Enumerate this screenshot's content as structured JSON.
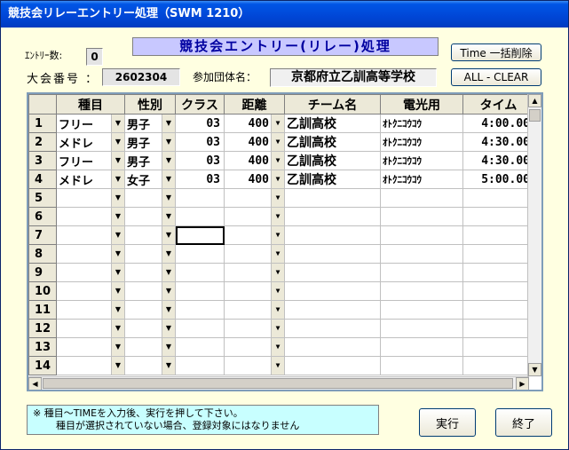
{
  "window": {
    "title": "競技会リレーエントリー処理（SWM 1210）"
  },
  "header": {
    "entry_count_label": "ｴﾝﾄﾘｰ数:",
    "entry_count_value": "0",
    "meet_number_label": "大会番号 ：",
    "meet_number_value": "2602304",
    "team_label": "参加団体名：",
    "team_value": "京都府立乙訓高等学校",
    "banner": "競技会エントリー(リレー)処理"
  },
  "toolbar": {
    "time_clear_label": "Time 一括削除",
    "all_clear_label": "ALL - CLEAR"
  },
  "grid": {
    "columns": [
      "種目",
      "性別",
      "クラス",
      "距離",
      "チーム名",
      "電光用",
      "タイム"
    ],
    "rows": [
      {
        "no": "1",
        "event": "フリー",
        "sex": "男子",
        "class": "03",
        "distance": "400",
        "team": "乙訓高校",
        "display": "ｵﾄｸﾆｺｳｺｳ",
        "time": "4:00.00"
      },
      {
        "no": "2",
        "event": "メドレ",
        "sex": "男子",
        "class": "03",
        "distance": "400",
        "team": "乙訓高校",
        "display": "ｵﾄｸﾆｺｳｺｳ",
        "time": "4:30.00"
      },
      {
        "no": "3",
        "event": "フリー",
        "sex": "男子",
        "class": "03",
        "distance": "400",
        "team": "乙訓高校",
        "display": "ｵﾄｸﾆｺｳｺｳ",
        "time": "4:30.00"
      },
      {
        "no": "4",
        "event": "メドレ",
        "sex": "女子",
        "class": "03",
        "distance": "400",
        "team": "乙訓高校",
        "display": "ｵﾄｸﾆｺｳｺｳ",
        "time": "5:00.00"
      },
      {
        "no": "5",
        "event": "",
        "sex": "",
        "class": "",
        "distance": "",
        "team": "",
        "display": "",
        "time": ""
      },
      {
        "no": "6",
        "event": "",
        "sex": "",
        "class": "",
        "distance": "",
        "team": "",
        "display": "",
        "time": ""
      },
      {
        "no": "7",
        "event": "",
        "sex": "",
        "class": "",
        "distance": "",
        "team": "",
        "display": "",
        "time": ""
      },
      {
        "no": "8",
        "event": "",
        "sex": "",
        "class": "",
        "distance": "",
        "team": "",
        "display": "",
        "time": ""
      },
      {
        "no": "9",
        "event": "",
        "sex": "",
        "class": "",
        "distance": "",
        "team": "",
        "display": "",
        "time": ""
      },
      {
        "no": "10",
        "event": "",
        "sex": "",
        "class": "",
        "distance": "",
        "team": "",
        "display": "",
        "time": ""
      },
      {
        "no": "11",
        "event": "",
        "sex": "",
        "class": "",
        "distance": "",
        "team": "",
        "display": "",
        "time": ""
      },
      {
        "no": "12",
        "event": "",
        "sex": "",
        "class": "",
        "distance": "",
        "team": "",
        "display": "",
        "time": ""
      },
      {
        "no": "13",
        "event": "",
        "sex": "",
        "class": "",
        "distance": "",
        "team": "",
        "display": "",
        "time": ""
      },
      {
        "no": "14",
        "event": "",
        "sex": "",
        "class": "",
        "distance": "",
        "team": "",
        "display": "",
        "time": ""
      }
    ]
  },
  "note": {
    "line1": "※ 種目～TIMEを入力後、実行を押して下さい。",
    "line2": "種目が選択されていない場合、登録対象にはなりません"
  },
  "buttons": {
    "execute": "実行",
    "exit": "終了"
  }
}
